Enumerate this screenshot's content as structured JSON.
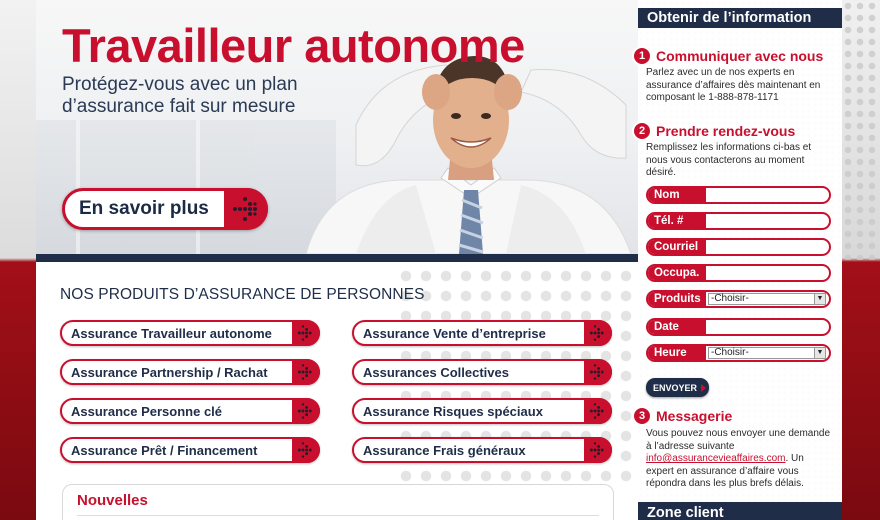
{
  "hero": {
    "title": "Travailleur autonome",
    "subtitle": "Protégez-vous avec un plan d’assurance fait sur mesure",
    "cta_label": "En savoir plus"
  },
  "products": {
    "section_title": "NOS PRODUITS D’ASSURANCE DE PERSONNES",
    "left": [
      "Assurance Travailleur autonome",
      "Assurance Partnership / Rachat",
      "Assurance Personne clé",
      "Assurance Prêt / Financement"
    ],
    "right": [
      "Assurance Vente d’entreprise",
      "Assurances Collectives",
      "Assurance Risques spéciaux",
      "Assurance Frais généraux"
    ]
  },
  "news": {
    "title": "Nouvelles"
  },
  "panel": {
    "heading": "Obtenir de l’information",
    "step1": {
      "num": "1",
      "title": "Communiquer avec nous",
      "text": "Parlez avec un de nos experts en assurance d’affaires dès maintenant en composant le 1-888-878-1171"
    },
    "step2": {
      "num": "2",
      "title": "Prendre rendez-vous",
      "text": "Remplissez les informations ci-bas et nous vous contacterons au moment désiré."
    },
    "form": {
      "nom": "Nom",
      "tel": "Tél. #",
      "courriel": "Courriel",
      "occupa": "Occupa.",
      "produits": "Produits",
      "produits_value": "-Choisir-",
      "date": "Date",
      "heure": "Heure",
      "heure_value": "-Choisir-",
      "submit": "ENVOYER"
    },
    "step3": {
      "num": "3",
      "title": "Messagerie",
      "text_before": "Vous pouvez nous envoyer une demande à l’adresse suivante",
      "email": "info@assurancevieaffaires.com",
      "text_after": ". Un expert en assurance d’affaire vous répondra dans les plus brefs délais."
    },
    "zone_client": "Zone client"
  },
  "colors": {
    "brand_red": "#c8102e",
    "navy": "#1f2d48"
  }
}
